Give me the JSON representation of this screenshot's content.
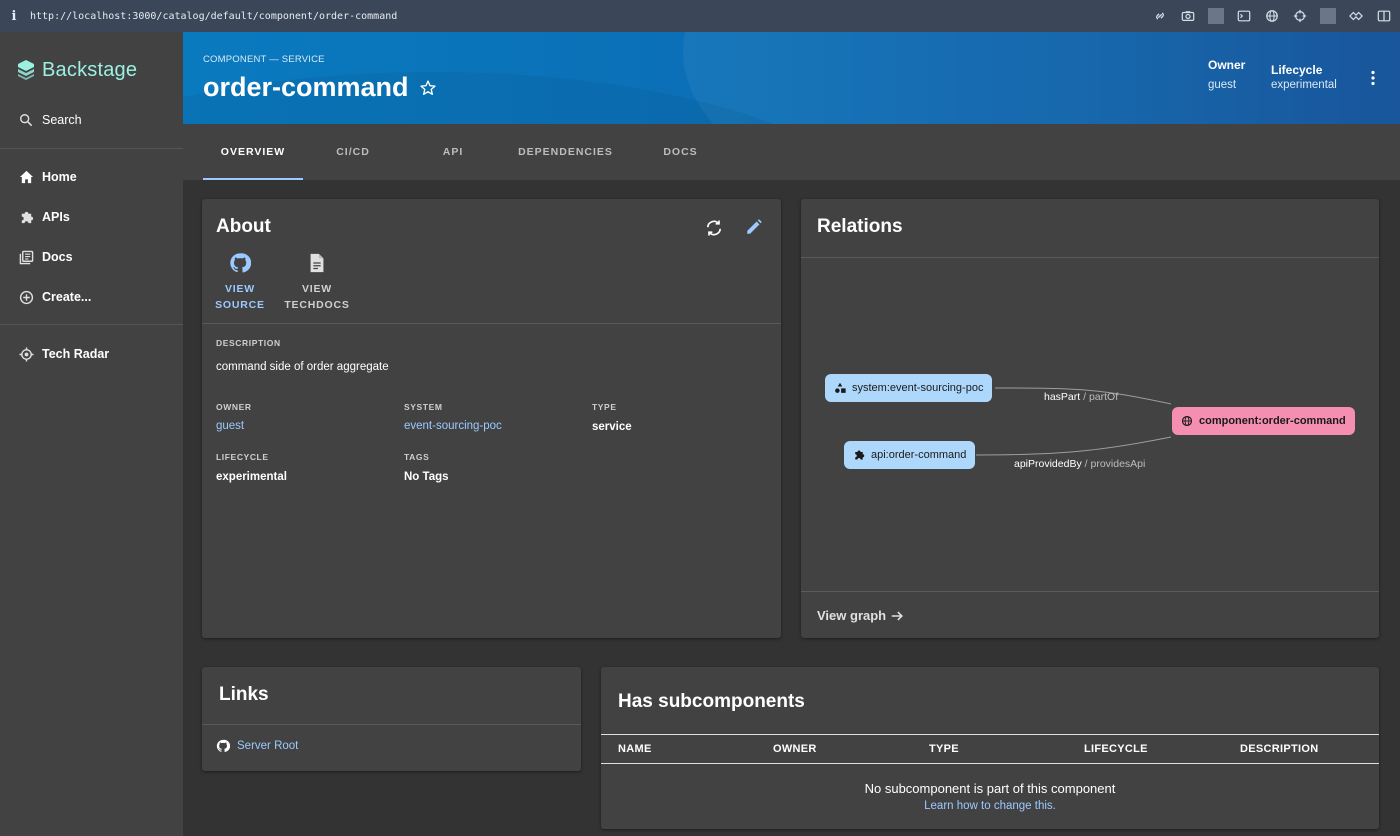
{
  "browser": {
    "url": "http://localhost:3000/catalog/default/component/order-command"
  },
  "sidebar": {
    "brand": "Backstage",
    "search_label": "Search",
    "items": [
      {
        "label": "Home"
      },
      {
        "label": "APIs"
      },
      {
        "label": "Docs"
      },
      {
        "label": "Create..."
      }
    ],
    "tech_radar_label": "Tech Radar"
  },
  "header": {
    "kind": "COMPONENT — SERVICE",
    "title": "order-command",
    "owner_label": "Owner",
    "owner_value": "guest",
    "lifecycle_label": "Lifecycle",
    "lifecycle_value": "experimental"
  },
  "tabs": [
    {
      "label": "OVERVIEW",
      "active": true
    },
    {
      "label": "CI/CD"
    },
    {
      "label": "API"
    },
    {
      "label": "DEPENDENCIES"
    },
    {
      "label": "DOCS"
    }
  ],
  "about": {
    "title": "About",
    "view_source_line1": "VIEW",
    "view_source_line2": "SOURCE",
    "view_techdocs_line1": "VIEW",
    "view_techdocs_line2": "TECHDOCS",
    "description_label": "DESCRIPTION",
    "description": "command side of order aggregate",
    "owner_label": "OWNER",
    "owner": "guest",
    "system_label": "SYSTEM",
    "system": "event-sourcing-poc",
    "type_label": "TYPE",
    "type": "service",
    "lifecycle_label": "LIFECYCLE",
    "lifecycle": "experimental",
    "tags_label": "TAGS",
    "tags": "No Tags"
  },
  "relations": {
    "title": "Relations",
    "nodes": {
      "system": "system:event-sourcing-poc",
      "api": "api:order-command",
      "component": "component:order-command"
    },
    "edges": [
      {
        "label": "hasPart",
        "inverse": "partOf"
      },
      {
        "label": "apiProvidedBy",
        "inverse": "providesApi"
      }
    ],
    "edge_separator": " / ",
    "view_graph_label": "View graph"
  },
  "links": {
    "title": "Links",
    "items": [
      {
        "label": "Server Root"
      }
    ]
  },
  "subcomponents": {
    "title": "Has subcomponents",
    "columns": [
      "NAME",
      "OWNER",
      "TYPE",
      "LIFECYCLE",
      "DESCRIPTION"
    ],
    "empty_message": "No subcomponent is part of this component",
    "empty_link": "Learn how to change this."
  },
  "colors": {
    "accent_link": "#9cc9ff",
    "brand": "#9bf0e1",
    "component_node": "#f48fb1",
    "related_node": "#aed8fb"
  }
}
